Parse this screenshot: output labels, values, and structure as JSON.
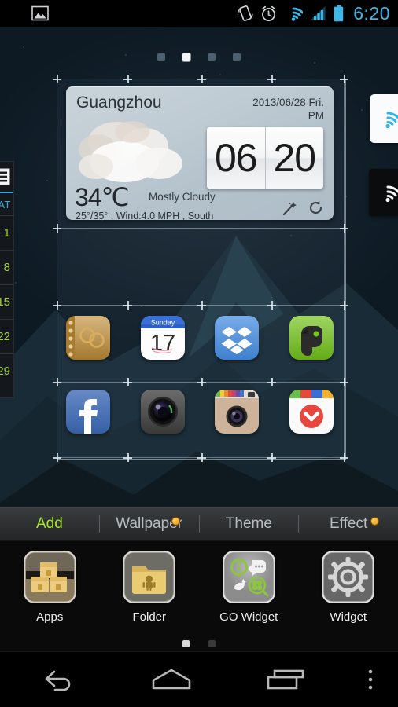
{
  "statusbar": {
    "time": "6:20",
    "time_color": "#3fb8e8",
    "icons": [
      {
        "name": "gallery-image-icon"
      },
      {
        "name": "vibrate-mode-icon"
      },
      {
        "name": "alarm-clock-icon"
      },
      {
        "name": "wifi-signal-icon"
      },
      {
        "name": "cellular-signal-icon"
      },
      {
        "name": "battery-full-icon"
      }
    ]
  },
  "homescreen": {
    "page_count": 4,
    "active_page": 2,
    "edit_mode": true,
    "weather_widget": {
      "city": "Guangzhou",
      "date": "2013/06/28 Fri.",
      "meridiem": "PM",
      "temperature": "34℃",
      "condition": "Mostly Cloudy",
      "detail": "25°/35° , Wind:4.0 MPH , South",
      "clock_hour": "06",
      "clock_minute": "20",
      "actions": [
        {
          "name": "magic-wand-icon",
          "label": "Customize"
        },
        {
          "name": "refresh-icon",
          "label": "Refresh"
        }
      ]
    },
    "app_rows": [
      [
        {
          "name": "contacts-notebook-icon",
          "label": "Contacts"
        },
        {
          "name": "calendar-icon",
          "label": "Calendar",
          "weekday": "Sunday",
          "day": "17"
        },
        {
          "name": "dropbox-icon",
          "label": "Dropbox"
        },
        {
          "name": "evernote-icon",
          "label": "Evernote"
        }
      ],
      [
        {
          "name": "facebook-icon",
          "label": "Facebook"
        },
        {
          "name": "camera-icon",
          "label": "Camera"
        },
        {
          "name": "instagram-icon",
          "label": "Instagram"
        },
        {
          "name": "pocket-icon",
          "label": "Pocket"
        }
      ]
    ],
    "peek_left_widget": {
      "name": "calendar-widget-peek",
      "header": "AT",
      "dates": [
        "1",
        "8",
        "15",
        "22",
        "29"
      ],
      "accent_color": "#2fa8d8",
      "date_color": "#9fd130"
    },
    "peek_right_widgets": [
      {
        "name": "wifi-toggle-widget-light"
      },
      {
        "name": "wifi-toggle-widget-dark"
      }
    ]
  },
  "editor": {
    "tabs": [
      {
        "label": "Add",
        "active": true,
        "badge": false
      },
      {
        "label": "Wallpaper",
        "active": false,
        "badge": true
      },
      {
        "label": "Theme",
        "active": false,
        "badge": false
      },
      {
        "label": "Effect",
        "active": false,
        "badge": true
      }
    ],
    "active_tab_color": "#a8e62c",
    "badge_color": "#f08a12",
    "items": [
      {
        "label": "Apps",
        "icon": "apps-boxes-icon"
      },
      {
        "label": "Folder",
        "icon": "folder-icon"
      },
      {
        "label": "GO Widget",
        "icon": "go-widget-icon"
      },
      {
        "label": "Widget",
        "icon": "widget-gear-icon"
      }
    ],
    "page_count": 2,
    "active_page": 1
  },
  "navbar": {
    "buttons": [
      {
        "name": "back-button",
        "label": "Back"
      },
      {
        "name": "home-button",
        "label": "Home"
      },
      {
        "name": "recents-button",
        "label": "Recent apps"
      },
      {
        "name": "overflow-menu-button",
        "label": "Menu"
      }
    ]
  }
}
